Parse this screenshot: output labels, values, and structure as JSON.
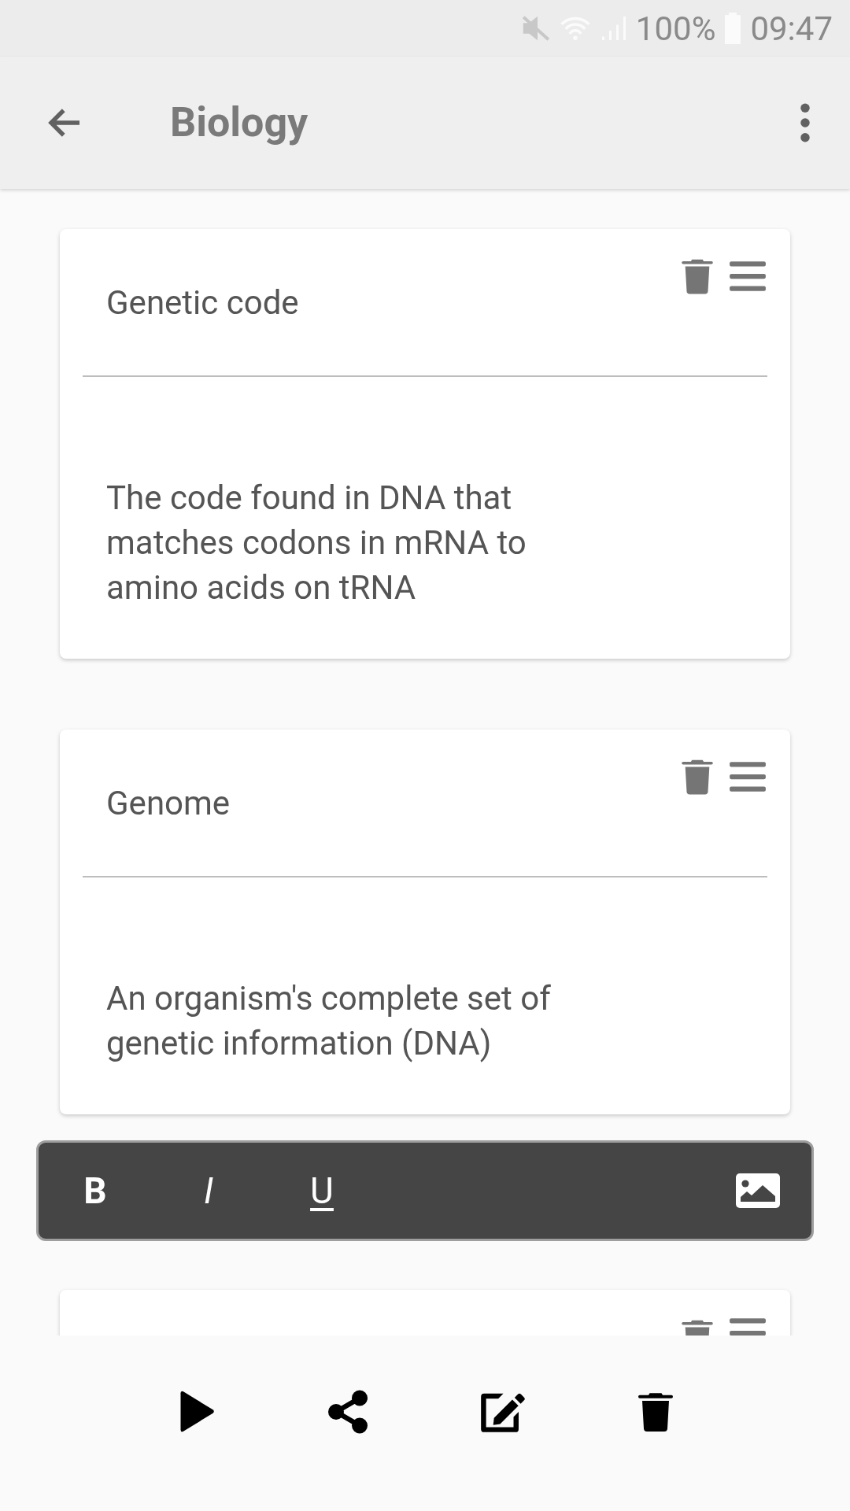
{
  "status_bar": {
    "battery": "100%",
    "time": "09:47"
  },
  "app_bar": {
    "title": "Biology"
  },
  "cards": [
    {
      "title": "Genetic code",
      "body": "The code found in DNA that matches codons in mRNA to amino acids on tRNA"
    },
    {
      "title": "Genome",
      "body": "An organism's complete set of genetic information (DNA)"
    }
  ],
  "format_bar": {
    "buttons": [
      {
        "kind": "bold",
        "label": "B"
      },
      {
        "kind": "italic",
        "label": "I"
      },
      {
        "kind": "underline",
        "label": "U"
      }
    ]
  }
}
